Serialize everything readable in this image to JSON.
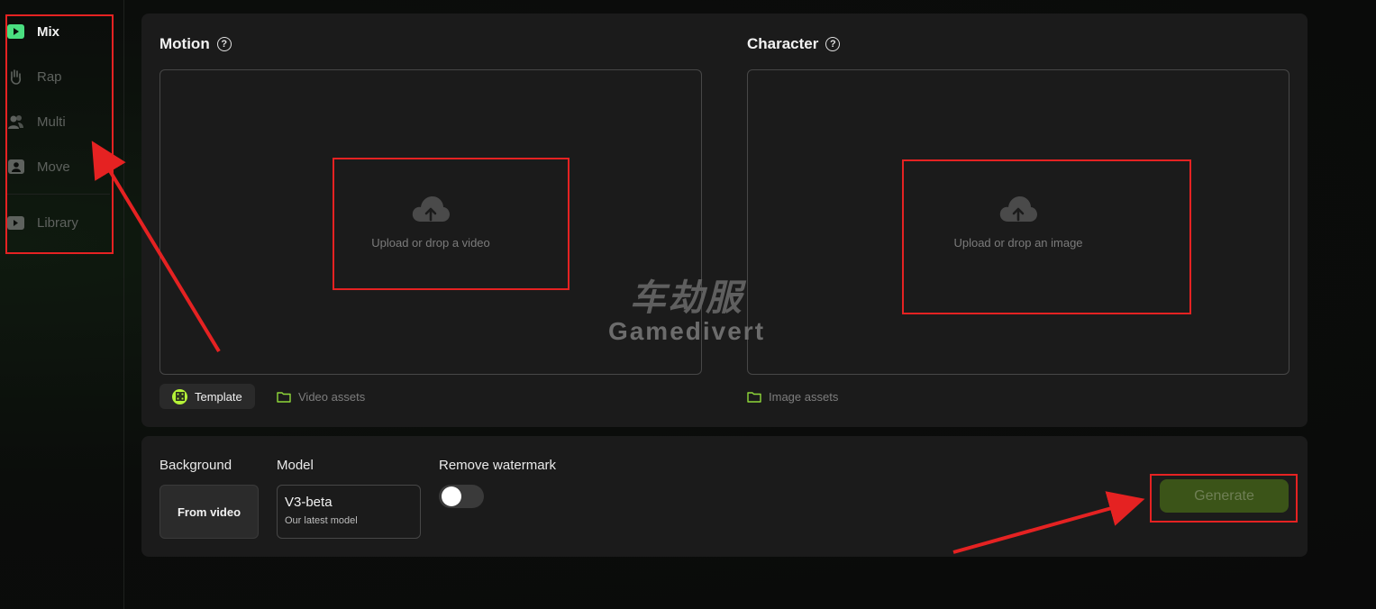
{
  "sidebar": {
    "items": [
      {
        "label": "Mix",
        "icon": "play-square-icon",
        "active": true
      },
      {
        "label": "Rap",
        "icon": "hand-icon",
        "active": false
      },
      {
        "label": "Multi",
        "icon": "users-icon",
        "active": false
      },
      {
        "label": "Move",
        "icon": "person-square-icon",
        "active": false
      },
      {
        "label": "Library",
        "icon": "video-library-icon",
        "active": false
      }
    ]
  },
  "motion": {
    "title": "Motion",
    "upload_label": "Upload or drop a video",
    "template_label": "Template",
    "assets_label": "Video assets"
  },
  "character": {
    "title": "Character",
    "upload_label": "Upload or drop an image",
    "assets_label": "Image assets"
  },
  "settings": {
    "background_label": "Background",
    "background_value": "From video",
    "model_label": "Model",
    "model_name": "V3-beta",
    "model_subtitle": "Our latest model",
    "watermark_label": "Remove watermark",
    "watermark_enabled": false
  },
  "generate_label": "Generate",
  "watermark_overlay": {
    "top": "车劫服",
    "bottom": "Gamedivert"
  },
  "colors": {
    "accent": "#b5f238",
    "generate_bg": "#3b5418",
    "annotation": "#e52222",
    "panel": "#1b1b1b"
  }
}
